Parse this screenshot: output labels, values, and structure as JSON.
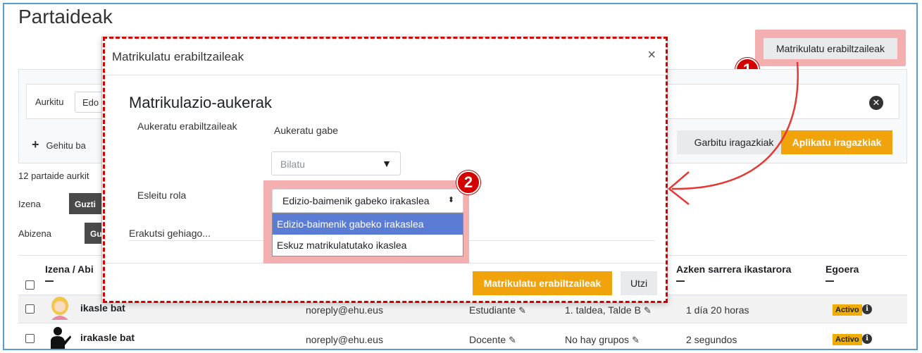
{
  "page": {
    "title": "Partaideak"
  },
  "header": {
    "enrol_users_button": "Matrikulatu erabiltzaileak"
  },
  "annotations": {
    "badge_1": "1",
    "badge_2": "2"
  },
  "filter": {
    "find_label": "Aurkitu",
    "find_value": "Edo",
    "add_condition": "Gehitu ba",
    "clear_filters": "Garbitu iragazkiak",
    "apply_filters": "Aplikatu iragazkiak"
  },
  "participants_count": "12 partaide aurkit",
  "initials": {
    "first_name_label": "Izena",
    "first_name_all": "Guzti",
    "last_name_label": "Abizena",
    "last_name_all": "Gu"
  },
  "table": {
    "headers": {
      "name": "Izena / Abi",
      "last_access": "Azken sarrera ikastarora",
      "status": "Egoera"
    },
    "rows": [
      {
        "name": "ikasle bat",
        "email": "noreply@ehu.eus",
        "role": "Estudiante",
        "groups": "1. taldea, Talde B",
        "last_access": "1 día 20 horas",
        "status": "Activo"
      },
      {
        "name": "irakasle bat",
        "email": "noreply@ehu.eus",
        "role": "Docente",
        "groups": "No hay grupos",
        "last_access": "2 segundos",
        "status": "Activo"
      }
    ]
  },
  "modal": {
    "title": "Matrikulatu erabiltzaileak",
    "close": "×",
    "section_title": "Matrikulazio-aukerak",
    "select_users_label": "Aukeratu erabiltzaileak",
    "no_selection": "Aukeratu gabe",
    "search_placeholder": "Bilatu",
    "search_arrow": "▼",
    "assign_role_label": "Esleitu rola",
    "role_selected": "Edizio-baimenik gabeko irakaslea",
    "role_options": [
      "Edizio-baimenik gabeko irakaslea",
      "Eskuz matrikulatutako ikaslea"
    ],
    "show_more": "Erakutsi gehiago...",
    "enrol_button": "Matrikulatu erabiltzaileak",
    "cancel_button": "Utzi"
  },
  "colors": {
    "accent": "#f0a30a",
    "annotation_red": "#d40000",
    "highlight_pink": "#f4b0b0",
    "dropdown_selected": "#5b7cd4"
  }
}
